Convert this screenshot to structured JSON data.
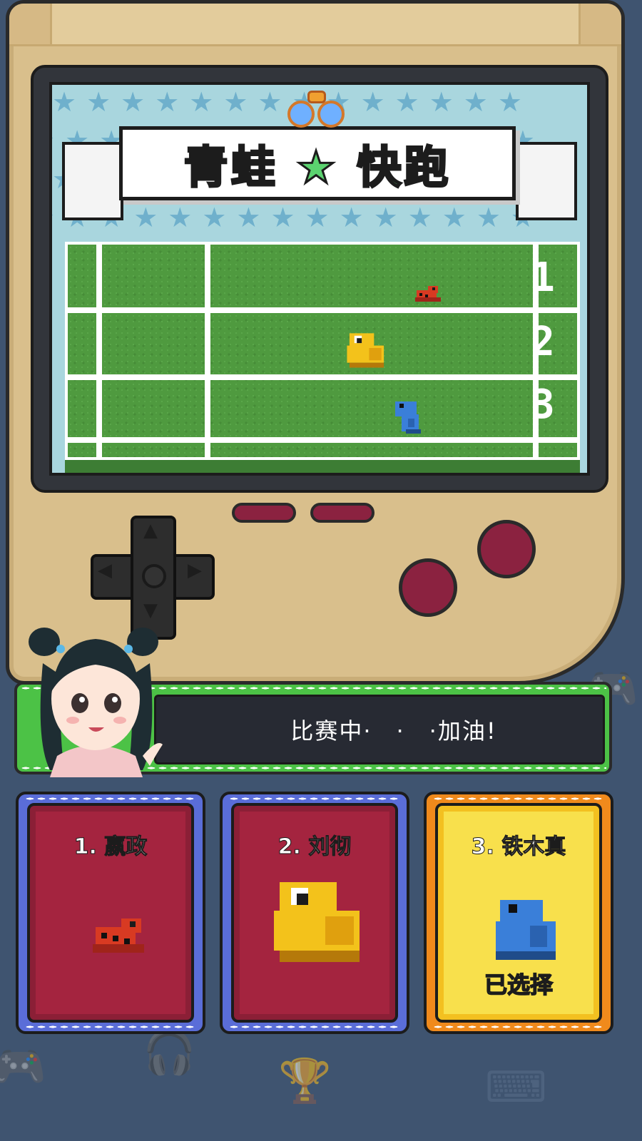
{
  "game": {
    "title": "青蛙 ★ 快跑"
  },
  "race": {
    "lanes": [
      {
        "number": "1",
        "frog": "red-frog",
        "color": "#d83a22",
        "progress": 0.7
      },
      {
        "number": "2",
        "frog": "yellow-frog",
        "color": "#f3c21b",
        "progress": 0.58
      },
      {
        "number": "3",
        "frog": "blue-frog",
        "color": "#3a7fd9",
        "progress": 0.66
      }
    ]
  },
  "commentary": {
    "message": "比赛中·　·　·加油!"
  },
  "contestants": [
    {
      "label": "1. 嬴政",
      "frog": "red-frog",
      "color": "#d83a22",
      "selected": false,
      "status": ""
    },
    {
      "label": "2. 刘彻",
      "frog": "yellow-frog",
      "color": "#f3c21b",
      "selected": false,
      "status": ""
    },
    {
      "label": "3. 铁木真",
      "frog": "blue-frog",
      "color": "#3a7fd9",
      "selected": true,
      "status": "已选择"
    }
  ],
  "colors": {
    "console": "#d9bf8c",
    "screen_bg": "#a9d6de",
    "track_green": "#4f9a3f",
    "button_red": "#8b2240",
    "card_red": "#a4243f",
    "card_yellow": "#f8e04c",
    "selected_text": "#38c234"
  }
}
